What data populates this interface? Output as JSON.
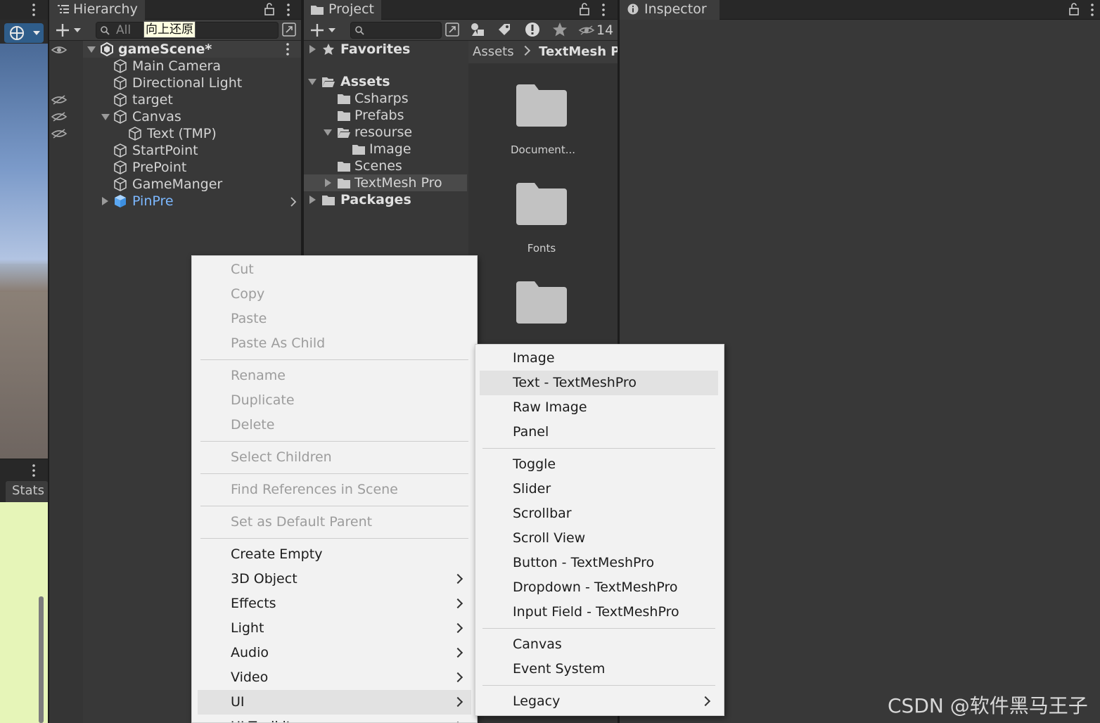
{
  "hierarchy": {
    "tab_label": "Hierarchy",
    "search_placeholder": "All",
    "tooltip": "向上还原",
    "scene_name": "gameScene*",
    "items": [
      {
        "label": "Main Camera"
      },
      {
        "label": "Directional Light"
      },
      {
        "label": "target"
      },
      {
        "label": "Canvas"
      },
      {
        "label": "Text (TMP)"
      },
      {
        "label": "StartPoint"
      },
      {
        "label": "PrePoint"
      },
      {
        "label": "GameManger"
      },
      {
        "label": "PinPre"
      }
    ]
  },
  "project": {
    "tab_label": "Project",
    "hidden_count": "14",
    "tree": [
      {
        "label": "Favorites"
      },
      {
        "label": "Assets"
      },
      {
        "label": "Csharps"
      },
      {
        "label": "Prefabs"
      },
      {
        "label": "resourse"
      },
      {
        "label": "Image"
      },
      {
        "label": "Scenes"
      },
      {
        "label": "TextMesh Pro"
      },
      {
        "label": "Packages"
      }
    ],
    "breadcrumb": {
      "root": "Assets",
      "current": "TextMesh Pro"
    },
    "assets": [
      {
        "label": "Document..."
      },
      {
        "label": "Fonts"
      }
    ]
  },
  "inspector": {
    "tab_label": "Inspector"
  },
  "game": {
    "stats_label": "Stats"
  },
  "context_menu": {
    "items": [
      {
        "label": "Cut"
      },
      {
        "label": "Copy"
      },
      {
        "label": "Paste"
      },
      {
        "label": "Paste As Child"
      },
      {
        "label": "Rename"
      },
      {
        "label": "Duplicate"
      },
      {
        "label": "Delete"
      },
      {
        "label": "Select Children"
      },
      {
        "label": "Find References in Scene"
      },
      {
        "label": "Set as Default Parent"
      },
      {
        "label": "Create Empty"
      },
      {
        "label": "3D Object"
      },
      {
        "label": "Effects"
      },
      {
        "label": "Light"
      },
      {
        "label": "Audio"
      },
      {
        "label": "Video"
      },
      {
        "label": "UI"
      },
      {
        "label": "UI Toolkit"
      }
    ]
  },
  "ui_submenu": {
    "items": [
      {
        "label": "Image"
      },
      {
        "label": "Text - TextMeshPro"
      },
      {
        "label": "Raw Image"
      },
      {
        "label": "Panel"
      },
      {
        "label": "Toggle"
      },
      {
        "label": "Slider"
      },
      {
        "label": "Scrollbar"
      },
      {
        "label": "Scroll View"
      },
      {
        "label": "Button - TextMeshPro"
      },
      {
        "label": "Dropdown - TextMeshPro"
      },
      {
        "label": "Input Field - TextMeshPro"
      },
      {
        "label": "Canvas"
      },
      {
        "label": "Event System"
      },
      {
        "label": "Legacy"
      }
    ]
  },
  "watermark": "CSDN @软件黑马王子",
  "colors": {
    "accent_blue": "#7cb8ff",
    "menu_bg": "#f2f2f2",
    "highlight": "#e2e2e2"
  }
}
